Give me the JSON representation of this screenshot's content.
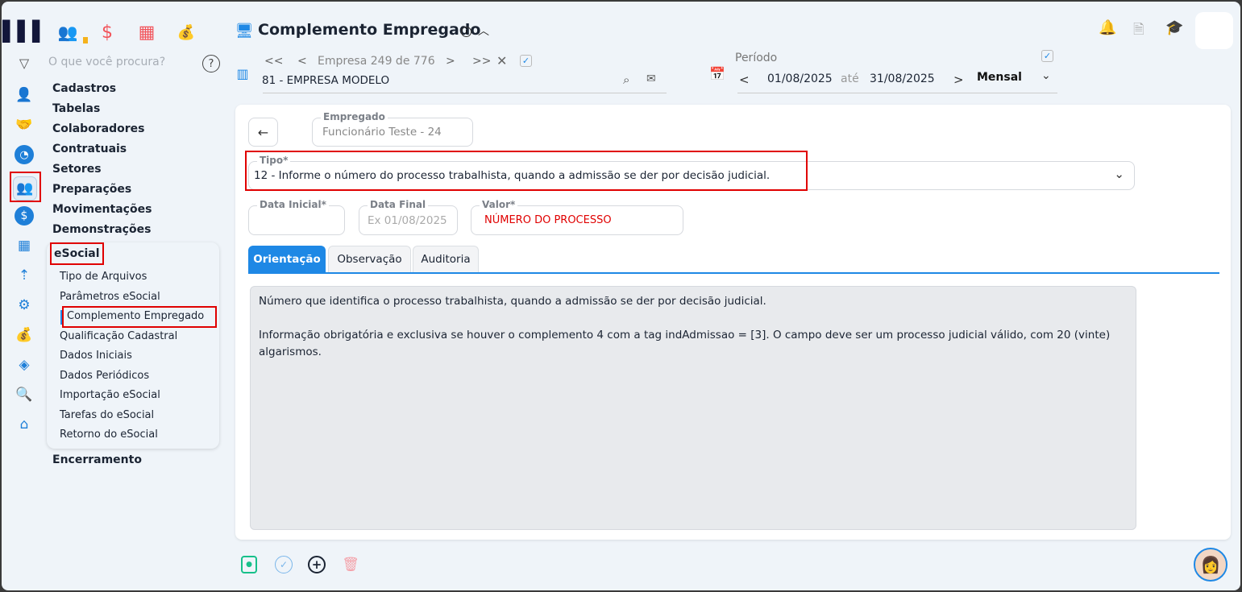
{
  "topbar": {
    "search_placeholder": "O que você procura?"
  },
  "menu": {
    "items": [
      "Cadastros",
      "Tabelas",
      "Colaboradores",
      "Contratuais",
      "Setores",
      "Preparações",
      "Movimentações",
      "Demonstrações"
    ],
    "section": "eSocial",
    "sub_items": [
      "Tipo de Arquivos",
      "Parâmetros eSocial",
      "Complemento Empregado",
      "Qualificação Cadastral",
      "Dados Iniciais",
      "Dados Periódicos",
      "Importação eSocial",
      "Tarefas do eSocial",
      "Retorno do eSocial"
    ],
    "last": "Encerramento"
  },
  "header": {
    "title": "Complemento Empregado",
    "empresa_nav": "Empresa 249 de 776",
    "empresa": "81 - EMPRESA MODELO",
    "periodo_label": "Período",
    "date_from": "01/08/2025",
    "ate": "até",
    "date_to": "31/08/2025",
    "periodicity": "Mensal"
  },
  "form": {
    "empregado_label": "Empregado",
    "empregado": "Funcionário Teste - 24",
    "tipo_label": "Tipo*",
    "tipo": "12 - Informe o número do processo trabalhista, quando a admissão se der por decisão judicial.",
    "data_inicial_label": "Data Inicial*",
    "data_final_label": "Data Final",
    "data_final_placeholder": "Ex 01/08/2025",
    "valor_label": "Valor*",
    "valor": "NÚMERO DO PROCESSO"
  },
  "tabs": [
    "Orientação",
    "Observação",
    "Auditoria"
  ],
  "orientacao": {
    "p1": "Número que identifica o processo trabalhista, quando a admissão se der por decisão judicial.",
    "p2": "Informação obrigatória e exclusiva se houver o complemento 4 com a tag indAdmissao = [3]. O campo deve ser um processo judicial válido, com 20 (vinte) algarismos."
  },
  "colors": {
    "accent": "#1e88e5",
    "highlight": "#e00000"
  }
}
